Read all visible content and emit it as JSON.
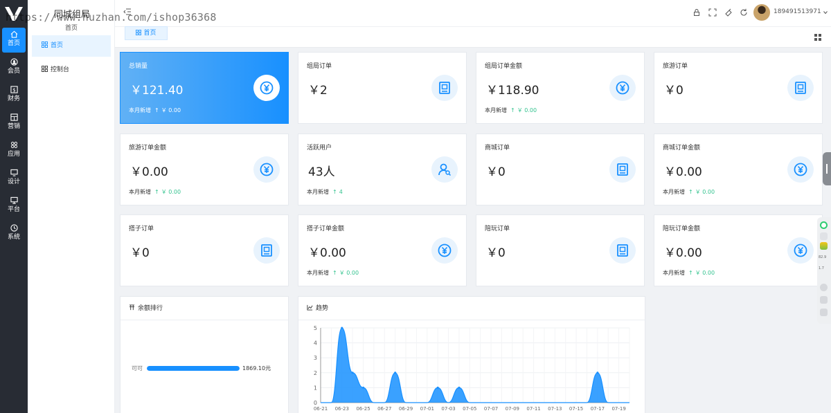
{
  "watermark": "https://www.huzhan.com/ishop36368",
  "app": {
    "title": "同城组局",
    "subtitle": "首页"
  },
  "rail": [
    {
      "label": "首页",
      "icon": "home-icon",
      "active": true
    },
    {
      "label": "会员",
      "icon": "member-icon"
    },
    {
      "label": "财务",
      "icon": "finance-icon"
    },
    {
      "label": "营销",
      "icon": "marketing-icon"
    },
    {
      "label": "应用",
      "icon": "apps-icon"
    },
    {
      "label": "设计",
      "icon": "design-icon"
    },
    {
      "label": "平台",
      "icon": "platform-icon"
    },
    {
      "label": "系统",
      "icon": "system-icon"
    }
  ],
  "subnav": [
    {
      "label": "首页",
      "active": true
    },
    {
      "label": "控制台"
    }
  ],
  "header": {
    "username": "189491513971"
  },
  "tabs": [
    {
      "label": "首页"
    }
  ],
  "cards": [
    {
      "title": "总销量",
      "value": "￥121.40",
      "foot": "本月新增",
      "delta": "￥ 0.00",
      "icon": "yen-icon",
      "highlight": true
    },
    {
      "title": "组局订单",
      "value": "￥2",
      "icon": "order-icon"
    },
    {
      "title": "组局订单金额",
      "value": "￥118.90",
      "foot": "本月新增",
      "delta": "￥ 0.00",
      "icon": "yen-icon"
    },
    {
      "title": "旅游订单",
      "value": "￥0",
      "icon": "order-icon"
    },
    {
      "title": "旅游订单金额",
      "value": "￥0.00",
      "foot": "本月新增",
      "delta": "￥ 0.00",
      "icon": "yen-icon"
    },
    {
      "title": "活跃用户",
      "value": "43人",
      "foot": "本月新增",
      "delta": "4",
      "icon": "user-search-icon"
    },
    {
      "title": "商城订单",
      "value": "￥0",
      "icon": "order-icon"
    },
    {
      "title": "商城订单金额",
      "value": "￥0.00",
      "foot": "本月新增",
      "delta": "￥ 0.00",
      "icon": "yen-icon"
    },
    {
      "title": "搭子订单",
      "value": "￥0",
      "icon": "order-icon"
    },
    {
      "title": "搭子订单金额",
      "value": "￥0.00",
      "foot": "本月新增",
      "delta": "￥ 0.00",
      "icon": "yen-icon"
    },
    {
      "title": "陪玩订单",
      "value": "￥0",
      "icon": "order-icon"
    },
    {
      "title": "陪玩订单金额",
      "value": "￥0.00",
      "foot": "本月新增",
      "delta": "￥ 0.00",
      "icon": "yen-icon"
    }
  ],
  "balance_panel": {
    "title": "余额排行",
    "rows": [
      {
        "label": "可可",
        "value": "1869.10元",
        "fraction": 1.0
      }
    ]
  },
  "trend_panel": {
    "title": "趋势"
  },
  "float_bar": {
    "stat1": "82.9",
    "stat2": "1.7"
  },
  "colors": {
    "accent": "#1890ff",
    "rail_bg": "#282c34",
    "up_green": "#34c38f"
  },
  "chart_data": {
    "type": "area",
    "title": "趋势",
    "x": [
      "06-21",
      "06-22",
      "06-23",
      "06-24",
      "06-25",
      "06-26",
      "06-27",
      "06-28",
      "06-29",
      "06-30",
      "07-01",
      "07-02",
      "07-03",
      "07-04",
      "07-05",
      "07-06",
      "07-07",
      "07-08",
      "07-09",
      "07-10",
      "07-11",
      "07-12",
      "07-13",
      "07-14",
      "07-15",
      "07-16",
      "07-17",
      "07-18",
      "07-19",
      "07-20"
    ],
    "x_tick_labels": [
      "06-21",
      "06-23",
      "06-25",
      "06-27",
      "06-29",
      "07-01",
      "07-03",
      "07-05",
      "07-07",
      "07-09",
      "07-11",
      "07-13",
      "07-15",
      "07-17",
      "07-19"
    ],
    "series": [
      {
        "values": [
          0,
          0,
          5,
          2,
          1,
          0,
          0,
          2,
          0,
          0,
          0,
          1,
          0,
          1,
          0,
          0,
          0,
          0,
          0,
          0,
          0,
          0,
          0,
          0,
          0,
          0,
          2,
          0,
          0,
          0
        ]
      }
    ],
    "ylim": [
      0,
      5
    ],
    "yticks": [
      0,
      1,
      2,
      3,
      4,
      5
    ],
    "grid": true,
    "smooth": true,
    "color": "#1890ff"
  }
}
